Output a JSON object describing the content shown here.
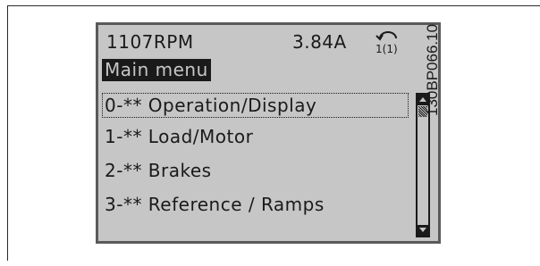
{
  "status": {
    "speed": "1107RPM",
    "current": "3.84A",
    "setup_indicator": "1(1)"
  },
  "screen": {
    "title": "Main menu"
  },
  "menu": {
    "items": [
      {
        "label": "0-** Operation/Display",
        "selected": true
      },
      {
        "label": "1-** Load/Motor",
        "selected": false
      },
      {
        "label": "2-** Brakes",
        "selected": false
      },
      {
        "label": "3-** Reference / Ramps",
        "selected": false
      }
    ]
  },
  "scrollbar": {
    "position": 0
  },
  "figure": {
    "reference_code": "130BP066.10"
  },
  "colors": {
    "lcd_background": "#c6c6c6",
    "lcd_foreground": "#1a1a1a"
  }
}
